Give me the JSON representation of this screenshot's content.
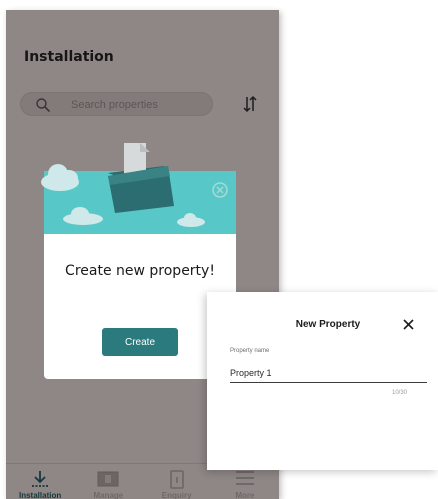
{
  "header": {
    "title": "Installation"
  },
  "search": {
    "placeholder": "Search properties",
    "icon": "search-icon"
  },
  "toolbar": {
    "sort_icon": "sort-icon"
  },
  "create_card": {
    "title": "Create new property!",
    "button_label": "Create",
    "accent": "#2b7a7e",
    "banner_color": "#58c7c7"
  },
  "new_property_panel": {
    "title": "New Property",
    "field_label": "Property name",
    "field_value": "Property 1",
    "counter": "10/30",
    "close_icon": "close-icon"
  },
  "bottom_nav": {
    "items": [
      {
        "label": "Installation",
        "icon": "download-icon",
        "active": true
      },
      {
        "label": "Manage",
        "icon": "manage-icon",
        "active": false
      },
      {
        "label": "Enquiry",
        "icon": "enquiry-icon",
        "active": false
      },
      {
        "label": "More",
        "icon": "menu-icon",
        "active": false
      }
    ]
  }
}
